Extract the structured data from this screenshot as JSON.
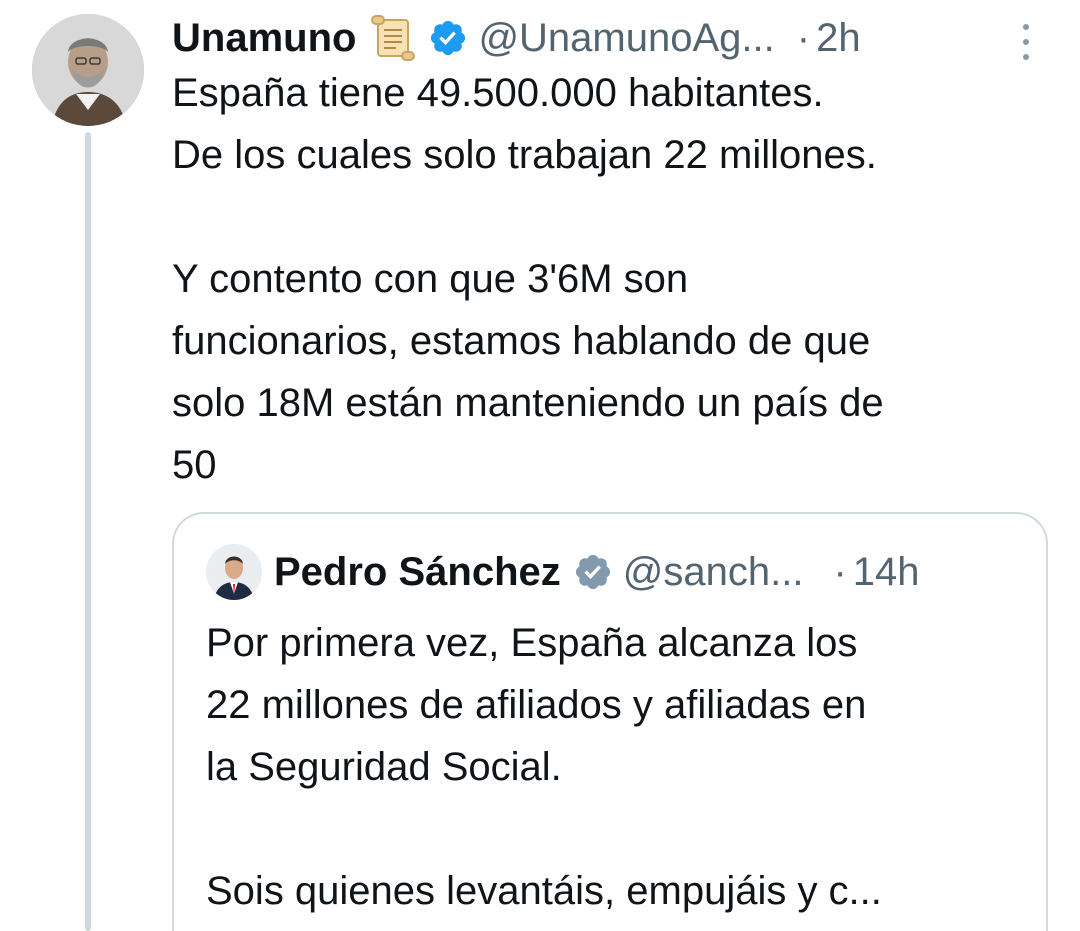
{
  "tweet": {
    "author_name": "Unamuno",
    "author_emoji": "scroll-icon",
    "handle": "@UnamunoAg...",
    "separator": "·",
    "time": "2h",
    "text_lines": [
      "España tiene 49.500.000 habitantes.",
      "De los cuales solo trabajan 22 millones.",
      "",
      "Y contento con que 3'6M son",
      "funcionarios, estamos hablando de que",
      "solo 18M están manteniendo un país de",
      "50"
    ],
    "verified_color": "#1d9bf0"
  },
  "quoted_tweet": {
    "author_name": "Pedro Sánchez",
    "handle": "@sanch...",
    "separator": "·",
    "time": "14h",
    "text_lines": [
      "Por primera vez, España alcanza los",
      "22 millones de afiliados y afiliadas en",
      "la Seguridad Social.",
      "",
      "Sois quienes levantáis, empujáis y c..."
    ],
    "verified_color": "#829aab"
  },
  "colors": {
    "text": "#0f1419",
    "secondary": "#536471",
    "border": "#cfd9de"
  }
}
